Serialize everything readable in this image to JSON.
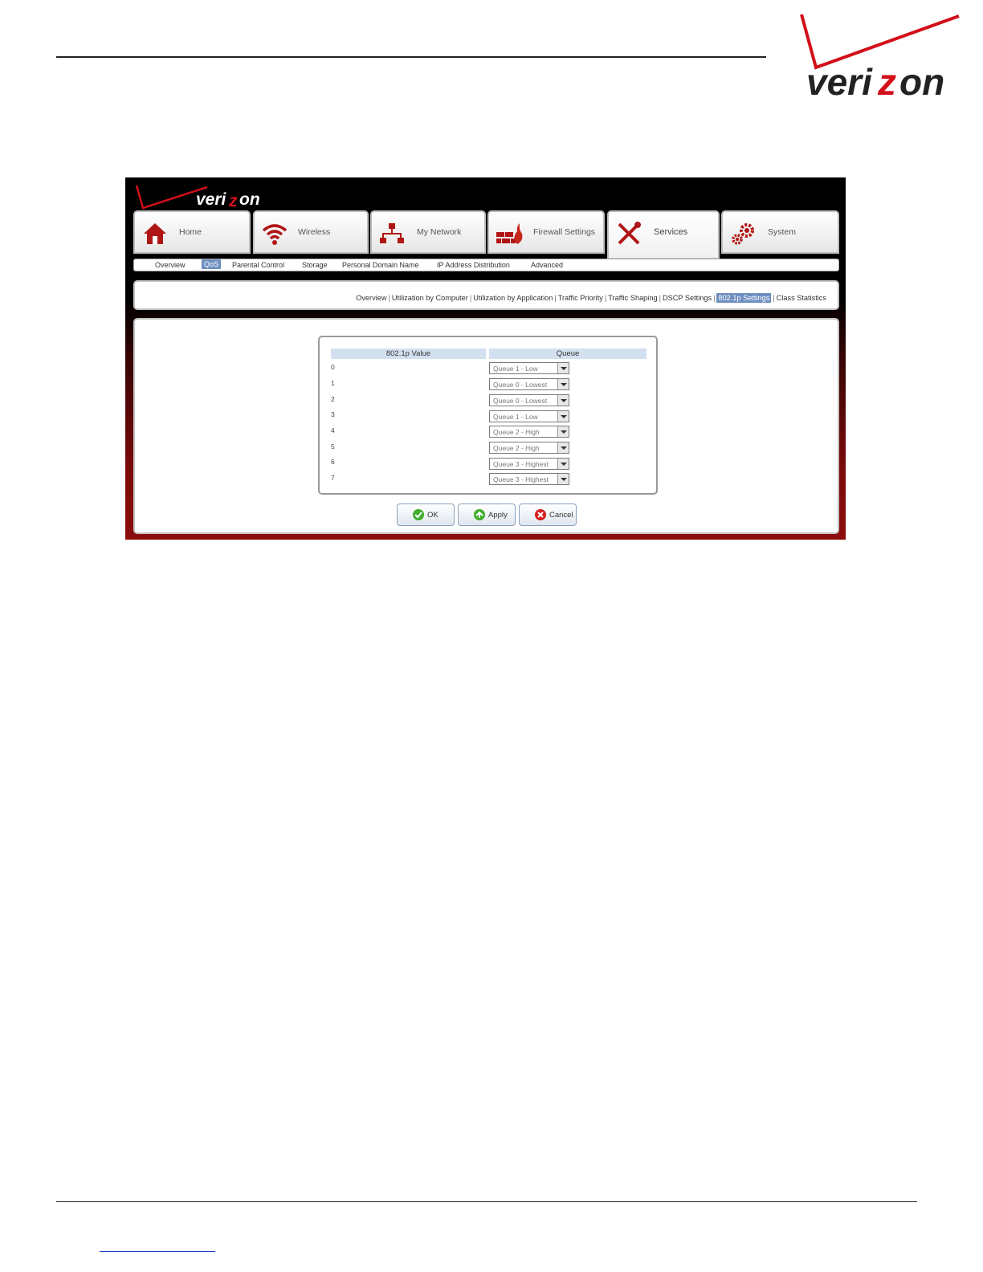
{
  "brand": {
    "logo_text": "verizon"
  },
  "main_tabs": [
    {
      "label": "Home",
      "icon": "home-icon"
    },
    {
      "label": "Wireless",
      "icon": "wireless-icon"
    },
    {
      "label": "My Network",
      "icon": "network-icon"
    },
    {
      "label": "Firewall Settings",
      "icon": "firewall-icon"
    },
    {
      "label": "Services",
      "icon": "tools-icon",
      "active": true
    },
    {
      "label": "System",
      "icon": "gears-icon"
    }
  ],
  "sub_nav": [
    "Overview",
    "QoS",
    "Parental Control",
    "Storage",
    "Personal Domain Name",
    "IP Address Distribution",
    "Advanced"
  ],
  "sub_nav_selected": "QoS",
  "qos_nav": [
    "Overview",
    "Utilization by Computer",
    "Utilization by Application",
    "Traffic Priority",
    "Traffic Shaping",
    "DSCP Settings",
    "802.1p Settings",
    "Class Statistics"
  ],
  "qos_nav_selected": "802.1p Settings",
  "table": {
    "headers": {
      "value": "802.1p Value",
      "queue": "Queue"
    },
    "rows": [
      {
        "value": "0",
        "queue": "Queue 1 - Low"
      },
      {
        "value": "1",
        "queue": "Queue 0 - Lowest"
      },
      {
        "value": "2",
        "queue": "Queue 0 - Lowest"
      },
      {
        "value": "3",
        "queue": "Queue 1 - Low"
      },
      {
        "value": "4",
        "queue": "Queue 2 - High"
      },
      {
        "value": "5",
        "queue": "Queue 2 - High"
      },
      {
        "value": "6",
        "queue": "Queue 3 - Highest"
      },
      {
        "value": "7",
        "queue": "Queue 3 - Highest"
      }
    ]
  },
  "buttons": {
    "ok": "OK",
    "apply": "Apply",
    "cancel": "Cancel"
  },
  "colors": {
    "brand_red": "#cd040b",
    "header_black": "#000000",
    "selection_blue": "#6e8fbf",
    "table_header": "#d3e0ef"
  }
}
